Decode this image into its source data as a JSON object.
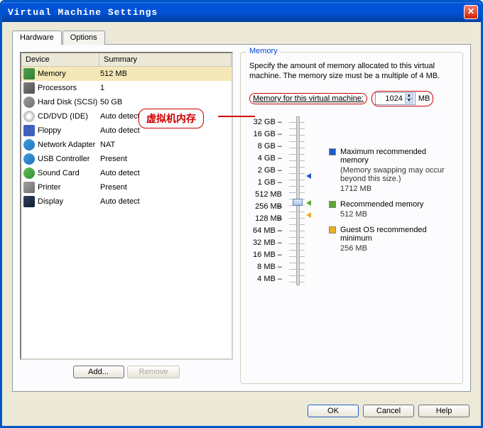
{
  "window": {
    "title": "Virtual Machine Settings"
  },
  "tabs": {
    "hardware": "Hardware",
    "options": "Options"
  },
  "list": {
    "head_device": "Device",
    "head_summary": "Summary",
    "rows": [
      {
        "device": "Memory",
        "summary": "512 MB",
        "icon": "ic-mem",
        "selected": true
      },
      {
        "device": "Processors",
        "summary": "1",
        "icon": "ic-cpu"
      },
      {
        "device": "Hard Disk (SCSI)",
        "summary": "50 GB",
        "icon": "ic-hd"
      },
      {
        "device": "CD/DVD (IDE)",
        "summary": "Auto detect",
        "icon": "ic-cd"
      },
      {
        "device": "Floppy",
        "summary": "Auto detect",
        "icon": "ic-fl"
      },
      {
        "device": "Network Adapter",
        "summary": "NAT",
        "icon": "ic-net"
      },
      {
        "device": "USB Controller",
        "summary": "Present",
        "icon": "ic-usb"
      },
      {
        "device": "Sound Card",
        "summary": "Auto detect",
        "icon": "ic-snd"
      },
      {
        "device": "Printer",
        "summary": "Present",
        "icon": "ic-prn"
      },
      {
        "device": "Display",
        "summary": "Auto detect",
        "icon": "ic-dsp"
      }
    ]
  },
  "buttons": {
    "add": "Add...",
    "remove": "Remove",
    "ok": "OK",
    "cancel": "Cancel",
    "help": "Help"
  },
  "memory": {
    "group_label": "Memory",
    "desc": "Specify the amount of memory allocated to this virtual machine. The memory size must be a multiple of 4 MB.",
    "field_label": "Memory for this virtual machine:",
    "value": "1024",
    "unit": "MB",
    "ticks": [
      "32 GB",
      "16 GB",
      "8 GB",
      "4 GB",
      "2 GB",
      "1 GB",
      "512 MB",
      "256 MB",
      "128 MB",
      "64 MB",
      "32 MB",
      "16 MB",
      "8 MB",
      "4 MB"
    ],
    "legend": {
      "max_label": "Maximum recommended memory",
      "max_hint": "(Memory swapping may occur beyond this size.)",
      "max_value": "1712 MB",
      "rec_label": "Recommended memory",
      "rec_value": "512 MB",
      "guest_label": "Guest OS recommended minimum",
      "guest_value": "256 MB"
    }
  },
  "annotation": {
    "text": "虚拟机内存"
  }
}
